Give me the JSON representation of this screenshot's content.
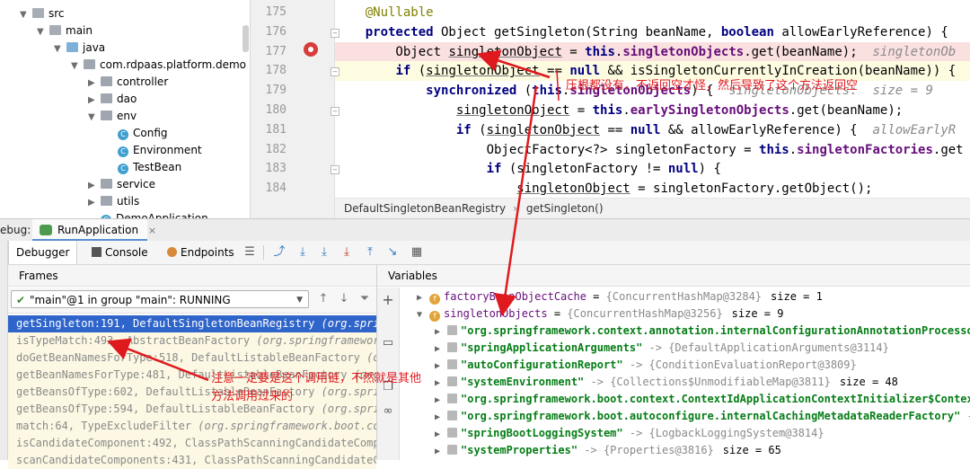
{
  "project_tree": {
    "items": [
      {
        "label": "src",
        "depth": 0,
        "arrow": "down",
        "icon": "folder"
      },
      {
        "label": "main",
        "depth": 1,
        "arrow": "down",
        "icon": "folder"
      },
      {
        "label": "java",
        "depth": 2,
        "arrow": "down",
        "icon": "source-folder"
      },
      {
        "label": "com.rdpaas.platform.demo",
        "depth": 3,
        "arrow": "down",
        "icon": "package"
      },
      {
        "label": "controller",
        "depth": 4,
        "arrow": "right",
        "icon": "package"
      },
      {
        "label": "dao",
        "depth": 4,
        "arrow": "right",
        "icon": "package"
      },
      {
        "label": "env",
        "depth": 4,
        "arrow": "down",
        "icon": "package"
      },
      {
        "label": "Config",
        "depth": 5,
        "arrow": "",
        "icon": "class"
      },
      {
        "label": "Environment",
        "depth": 5,
        "arrow": "",
        "icon": "class"
      },
      {
        "label": "TestBean",
        "depth": 5,
        "arrow": "",
        "icon": "class"
      },
      {
        "label": "service",
        "depth": 4,
        "arrow": "right",
        "icon": "package"
      },
      {
        "label": "utils",
        "depth": 4,
        "arrow": "right",
        "icon": "package"
      },
      {
        "label": "DemoApplication",
        "depth": 4,
        "arrow": "",
        "icon": "class"
      }
    ]
  },
  "editor": {
    "lines": [
      {
        "num": "175",
        "code": "@Nullable"
      },
      {
        "num": "176",
        "code": "protected Object getSingleton(String beanName, boolean allowEarlyReference) {"
      },
      {
        "num": "177",
        "code": "Object singletonObject = this.singletonObjects.get(beanName);",
        "inline_hint": "singletonOb"
      },
      {
        "num": "178",
        "code": "if (singletonObject == null && isSingletonCurrentlyInCreation(beanName)) {"
      },
      {
        "num": "179",
        "code": "synchronized (this.singletonObjects) {",
        "inline_hint": "singletonObjects:  size = 9"
      },
      {
        "num": "180",
        "code": "singletonObject = this.earlySingletonObjects.get(beanName);"
      },
      {
        "num": "181",
        "code": "if (singletonObject == null && allowEarlyReference) {",
        "inline_hint": "allowEarlyR"
      },
      {
        "num": "182",
        "code": "ObjectFactory<?> singletonFactory = this.singletonFactories.get"
      },
      {
        "num": "183",
        "code": "if (singletonFactory != null) {"
      },
      {
        "num": "184",
        "code": "singletonObject = singletonFactory.getObject();"
      }
    ],
    "breadcrumb": [
      "DefaultSingletonBeanRegistry",
      "getSingleton()"
    ]
  },
  "debug": {
    "label": "ebug:",
    "run_tab": "RunApplication",
    "close": "×",
    "tabs": [
      "Debugger",
      "Console",
      "Endpoints"
    ],
    "frames_title": "Frames",
    "variables_title": "Variables",
    "thread": "\"main\"@1 in group \"main\": RUNNING",
    "frames": [
      {
        "text": "getSingleton:191, DefaultSingletonBeanRegistry ",
        "pkg": "(org.springfr",
        "state": "selected"
      },
      {
        "text": "isTypeMatch:493, AbstractBeanFactory ",
        "pkg": "(org.springframework.be",
        "state": "lib"
      },
      {
        "text": "doGetBeanNamesForType:518, DefaultListableBeanFactory ",
        "pkg": "(org.spr",
        "state": "lib"
      },
      {
        "text": "getBeanNamesForType:481, DefaultListableBeanFactory ",
        "pkg": "(org.spri",
        "state": "lib"
      },
      {
        "text": "getBeansOfType:602, DefaultListableBeanFactory ",
        "pkg": "(org.springfr",
        "state": "lib"
      },
      {
        "text": "getBeansOfType:594, DefaultListableBeanFactory ",
        "pkg": "(org.springfr",
        "state": "lib"
      },
      {
        "text": "match:64, TypeExcludeFilter ",
        "pkg": "(org.springframework.boot.contex",
        "state": "lib"
      },
      {
        "text": "isCandidateComponent:492, ClassPathScanningCandidateComponent",
        "pkg": "",
        "state": "lib"
      },
      {
        "text": "scanCandidateComponents:431, ClassPathScanningCandidateCompone",
        "pkg": "",
        "state": "lib"
      }
    ],
    "variables": [
      {
        "indent": 0,
        "arrow": "right",
        "icon": "field",
        "name": "factoryBeanObjectCache",
        "ref": "{ConcurrentHashMap@3284}",
        "size": "size = 1"
      },
      {
        "indent": 0,
        "arrow": "down",
        "icon": "field",
        "name": "singletonObjects",
        "ref": "{ConcurrentHashMap@3256}",
        "size": "size = 9"
      },
      {
        "indent": 1,
        "arrow": "right",
        "icon": "entry",
        "name": "\"org.springframework.context.annotation.internalConfigurationAnnotationProcessor\"",
        "ref": "->",
        "size": ""
      },
      {
        "indent": 1,
        "arrow": "right",
        "icon": "entry",
        "name": "\"springApplicationArguments\"",
        "ref": "-> {DefaultApplicationArguments@3114}",
        "size": ""
      },
      {
        "indent": 1,
        "arrow": "right",
        "icon": "entry",
        "name": "\"autoConfigurationReport\"",
        "ref": "-> {ConditionEvaluationReport@3809}",
        "size": ""
      },
      {
        "indent": 1,
        "arrow": "right",
        "icon": "entry",
        "name": "\"systemEnvironment\"",
        "ref": "-> {Collections$UnmodifiableMap@3811}",
        "size": "size = 48"
      },
      {
        "indent": 1,
        "arrow": "right",
        "icon": "entry",
        "name": "\"org.springframework.boot.context.ContextIdApplicationContextInitializer$ContextId\"",
        "ref": "->",
        "size": ""
      },
      {
        "indent": 1,
        "arrow": "right",
        "icon": "entry",
        "name": "\"org.springframework.boot.autoconfigure.internalCachingMetadataReaderFactory\"",
        "ref": "-> {Sh",
        "size": ""
      },
      {
        "indent": 1,
        "arrow": "right",
        "icon": "entry",
        "name": "\"springBootLoggingSystem\"",
        "ref": "-> {LogbackLoggingSystem@3814}",
        "size": ""
      },
      {
        "indent": 1,
        "arrow": "right",
        "icon": "entry",
        "name": "\"systemProperties\"",
        "ref": "-> {Properties@3816}",
        "size": "size = 65"
      }
    ]
  },
  "annotations": {
    "note1": "压根都没有，不返回空才怪，然后导致了这个方法返回空",
    "note2_line1": "注意一定要是这个调用链，不然就是其他",
    "note2_line2": "方法调用过来的",
    "color": "#e0191e"
  },
  "colors": {
    "selection": "#2f65ca",
    "keyword": "#000080",
    "field": "#660e7a",
    "string_key": "#067d17",
    "breakpoint": "#d93a3a"
  }
}
